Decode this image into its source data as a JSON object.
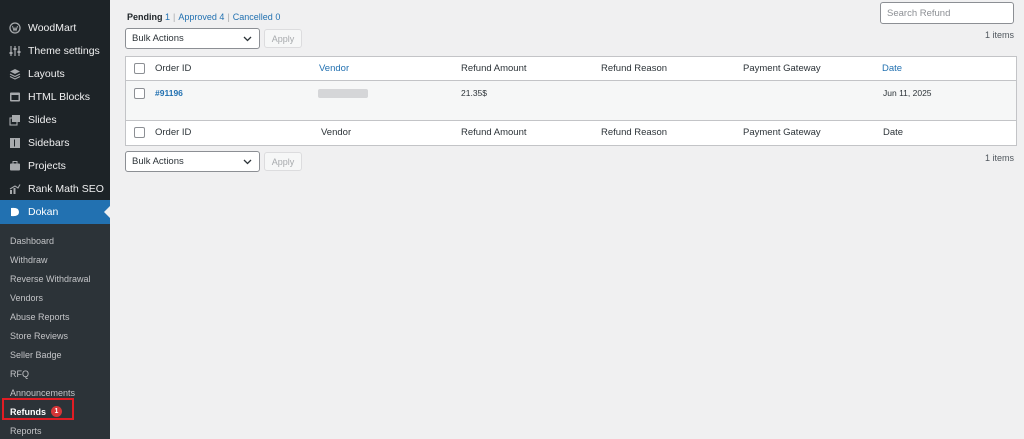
{
  "sidebar": {
    "items": [
      {
        "label": "WoodMart",
        "icon": "woodmart-icon"
      },
      {
        "label": "Theme settings",
        "icon": "sliders-icon"
      },
      {
        "label": "Layouts",
        "icon": "layers-icon"
      },
      {
        "label": "HTML Blocks",
        "icon": "html-block-icon"
      },
      {
        "label": "Slides",
        "icon": "slides-icon"
      },
      {
        "label": "Sidebars",
        "icon": "sidebar-icon"
      },
      {
        "label": "Projects",
        "icon": "briefcase-icon"
      },
      {
        "label": "Rank Math SEO",
        "icon": "rank-math-icon"
      },
      {
        "label": "Dokan",
        "icon": "dokan-icon"
      }
    ],
    "submenu": [
      {
        "label": "Dashboard"
      },
      {
        "label": "Withdraw"
      },
      {
        "label": "Reverse Withdrawal"
      },
      {
        "label": "Vendors"
      },
      {
        "label": "Abuse Reports"
      },
      {
        "label": "Store Reviews"
      },
      {
        "label": "Seller Badge"
      },
      {
        "label": "RFQ"
      },
      {
        "label": "Announcements"
      },
      {
        "label": "Refunds",
        "badge": "1"
      },
      {
        "label": "Reports"
      }
    ]
  },
  "filters": {
    "pending_label": "Pending",
    "pending_count": "1",
    "approved_label": "Approved",
    "approved_count": "4",
    "cancelled_label": "Cancelled",
    "cancelled_count": "0"
  },
  "search": {
    "placeholder": "Search Refund"
  },
  "bulk": {
    "label": "Bulk Actions",
    "apply": "Apply"
  },
  "items_count": "1 items",
  "table": {
    "columns": [
      "Order ID",
      "Vendor",
      "Refund Amount",
      "Refund Reason",
      "Payment Gateway",
      "Date"
    ],
    "rows": [
      {
        "order_id": "#91196",
        "vendor": "",
        "amount": "21.35$",
        "reason": "",
        "gateway": "",
        "date": "Jun 11, 2025"
      }
    ]
  },
  "colors": {
    "accent": "#2271b1",
    "sidebar_bg": "#1d2327",
    "highlight": "#e11d24",
    "badge": "#d63638"
  }
}
